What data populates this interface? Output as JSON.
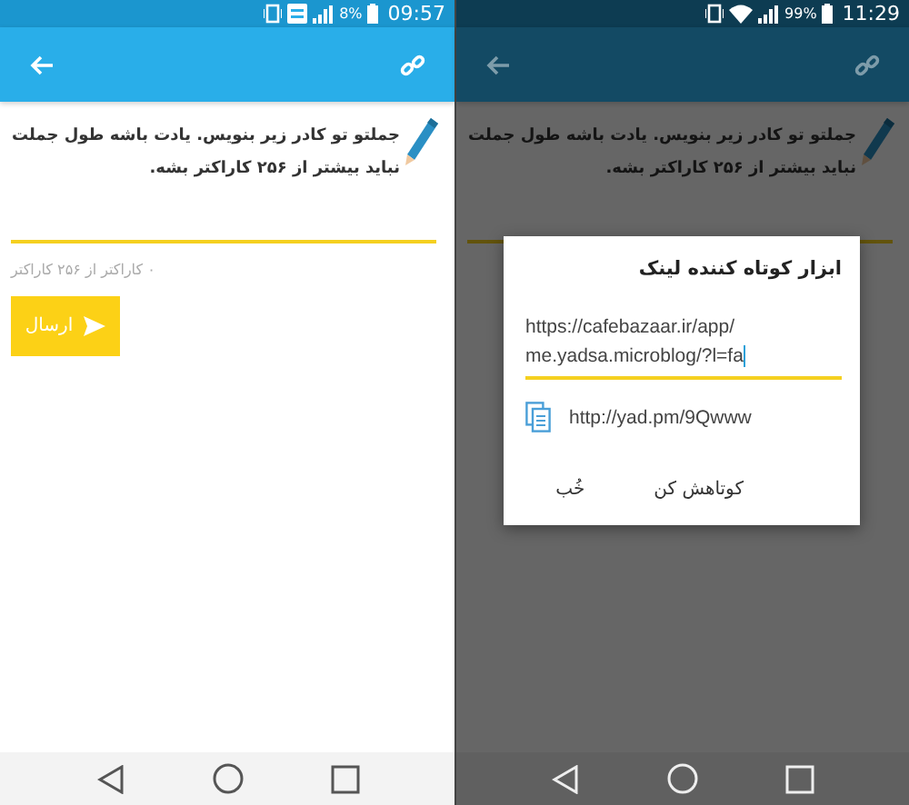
{
  "left_screen": {
    "status_bar": {
      "kind": "lte",
      "battery": "8%",
      "time": "09:57"
    },
    "dimmed": false,
    "instruction": "جملتو تو کادر زیر بنویس. یادت باشه طول جملت نباید بیشتر از ۲۵۶ کاراکتر بشه.",
    "counter": "۰ کاراکتر از ۲۵۶ کاراکتر",
    "send_button": "ارسال"
  },
  "right_screen": {
    "status_bar": {
      "kind": "wifi",
      "battery": "99%",
      "time": "11:29"
    },
    "dimmed": true,
    "instruction": "جملتو تو کادر زیر بنویس. یادت باشه طول جملت نباید بیشتر از ۲۵۶ کاراکتر بشه.",
    "dialog": {
      "title": "ابزار کوتاه کننده لینک",
      "url_value": "https://cafebazaar.ir/app/me.yadsa.microblog/?l=fa",
      "short_link": "http://yad.pm/9Qwww",
      "buttons": [
        "کوتاهش کن",
        "خُب"
      ]
    }
  }
}
